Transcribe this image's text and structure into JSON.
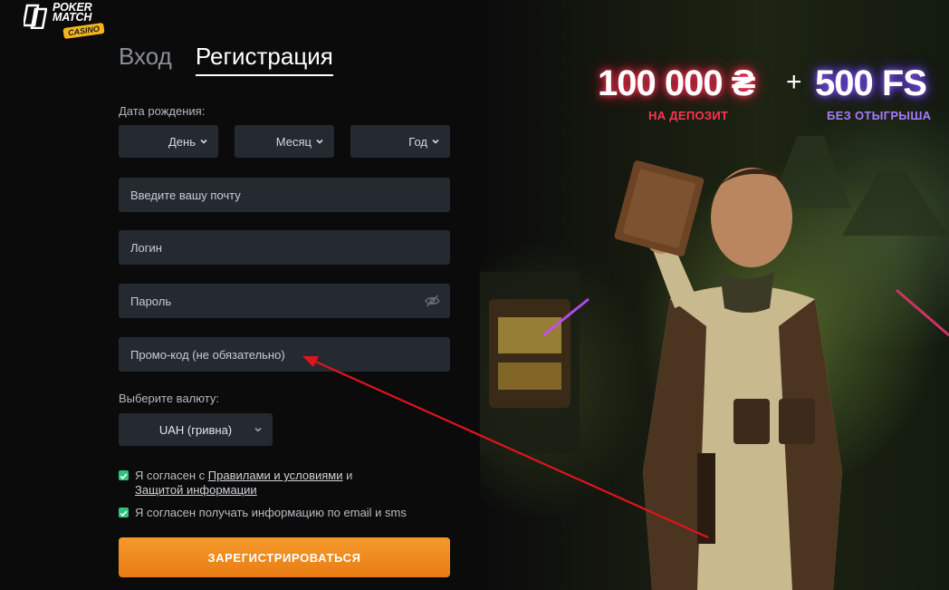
{
  "brand": {
    "line1": "POKER",
    "line2": "MATCH",
    "badge": "CASINO"
  },
  "tabs": [
    {
      "label": "Вход"
    },
    {
      "label": "Регистрация"
    }
  ],
  "birthdate": {
    "label": "Дата рождения:",
    "day": "День",
    "month": "Месяц",
    "year": "Год"
  },
  "fields": {
    "email_placeholder": "Введите вашу почту",
    "login_placeholder": "Логин",
    "password_placeholder": "Пароль",
    "promo_placeholder": "Промо-код (не обязательно)"
  },
  "currency": {
    "label": "Выберите валюту:",
    "selected": "UAH (гривна)"
  },
  "agreements": {
    "terms_prefix": "Я согласен с ",
    "terms_link": "Правилами и условиями",
    "terms_and": " и",
    "privacy_link": "Защитой информации",
    "marketing": "Я согласен получать информацию по email и sms"
  },
  "register_button": "ЗАРЕГИСТРИРОВАТЬСЯ",
  "promo": {
    "amount": "100 000 ₴",
    "plus": "+",
    "freespins": "500 FS",
    "amount_sub": "НА ДЕПОЗИТ",
    "freespins_sub": "БЕЗ ОТЫГРЫША"
  },
  "colors": {
    "accent_orange": "#F08A1E",
    "field_bg": "#252A31",
    "checkbox_green": "#2EC27E",
    "annotation_red": "#E0141E"
  },
  "icons": {
    "logo": "pokermatch-logo-icon",
    "chevron": "chevron-down-icon",
    "password_toggle": "eye-off-icon",
    "checkbox": "checkmark-icon"
  }
}
